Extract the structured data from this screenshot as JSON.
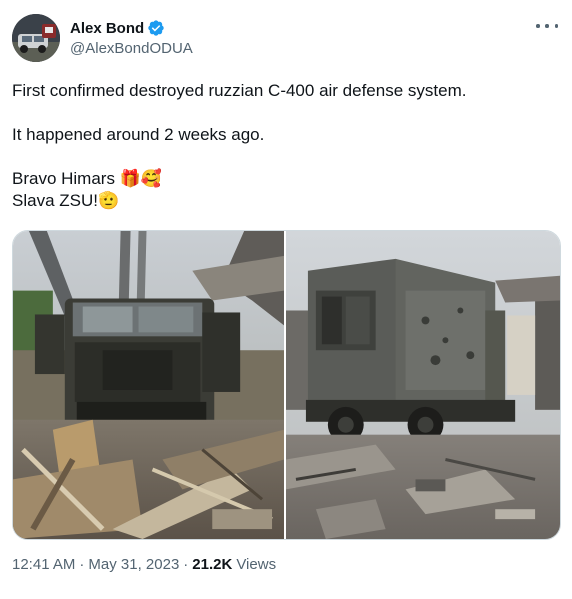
{
  "author": {
    "display_name": "Alex Bond",
    "handle": "@AlexBondODUA",
    "verified_icon": "verified-badge-icon"
  },
  "tweet": {
    "lines": [
      "First confirmed destroyed ruzzian  C-400 air defense system.",
      "",
      "It happened around 2 weeks ago.",
      "",
      "Bravo Himars 🎁🥰",
      "Slava ZSU!🫡"
    ]
  },
  "meta": {
    "time": "12:41 AM",
    "separator": "·",
    "date": "May 31, 2023",
    "views_count": "21.2K",
    "views_label": "Views"
  },
  "colors": {
    "text_primary": "#0f1419",
    "text_secondary": "#536471",
    "verified_blue": "#1d9bf0",
    "border": "#cfd9de"
  }
}
